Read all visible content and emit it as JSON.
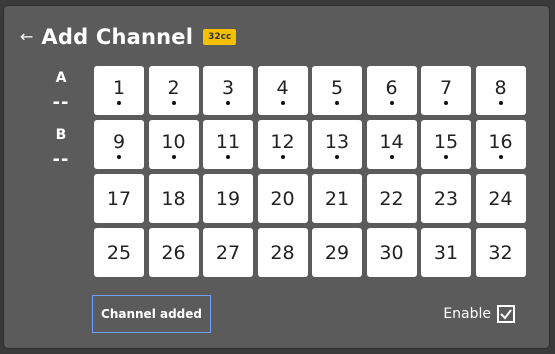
{
  "header": {
    "back_icon": "left-arrow-icon",
    "title": "Add Channel",
    "badge": "32cc"
  },
  "sides": [
    {
      "letter": "A",
      "value": "--"
    },
    {
      "letter": "B",
      "value": "--"
    }
  ],
  "channels": [
    {
      "label": "1",
      "dot": true
    },
    {
      "label": "2",
      "dot": true
    },
    {
      "label": "3",
      "dot": true
    },
    {
      "label": "4",
      "dot": true
    },
    {
      "label": "5",
      "dot": true
    },
    {
      "label": "6",
      "dot": true
    },
    {
      "label": "7",
      "dot": true
    },
    {
      "label": "8",
      "dot": true
    },
    {
      "label": "9",
      "dot": true
    },
    {
      "label": "10",
      "dot": true
    },
    {
      "label": "11",
      "dot": true
    },
    {
      "label": "12",
      "dot": true
    },
    {
      "label": "13",
      "dot": true
    },
    {
      "label": "14",
      "dot": true
    },
    {
      "label": "15",
      "dot": true
    },
    {
      "label": "16",
      "dot": true
    },
    {
      "label": "17",
      "dot": false
    },
    {
      "label": "18",
      "dot": false
    },
    {
      "label": "19",
      "dot": false
    },
    {
      "label": "20",
      "dot": false
    },
    {
      "label": "21",
      "dot": false
    },
    {
      "label": "22",
      "dot": false
    },
    {
      "label": "23",
      "dot": false
    },
    {
      "label": "24",
      "dot": false
    },
    {
      "label": "25",
      "dot": false
    },
    {
      "label": "26",
      "dot": false
    },
    {
      "label": "27",
      "dot": false
    },
    {
      "label": "28",
      "dot": false
    },
    {
      "label": "29",
      "dot": false
    },
    {
      "label": "30",
      "dot": false
    },
    {
      "label": "31",
      "dot": false
    },
    {
      "label": "32",
      "dot": false
    }
  ],
  "status": {
    "text": "Channel added"
  },
  "enable": {
    "label": "Enable",
    "checked": true
  },
  "colors": {
    "background": "#5b5b5b",
    "badge": "#f5c000",
    "status_border": "#6fa0ff"
  }
}
